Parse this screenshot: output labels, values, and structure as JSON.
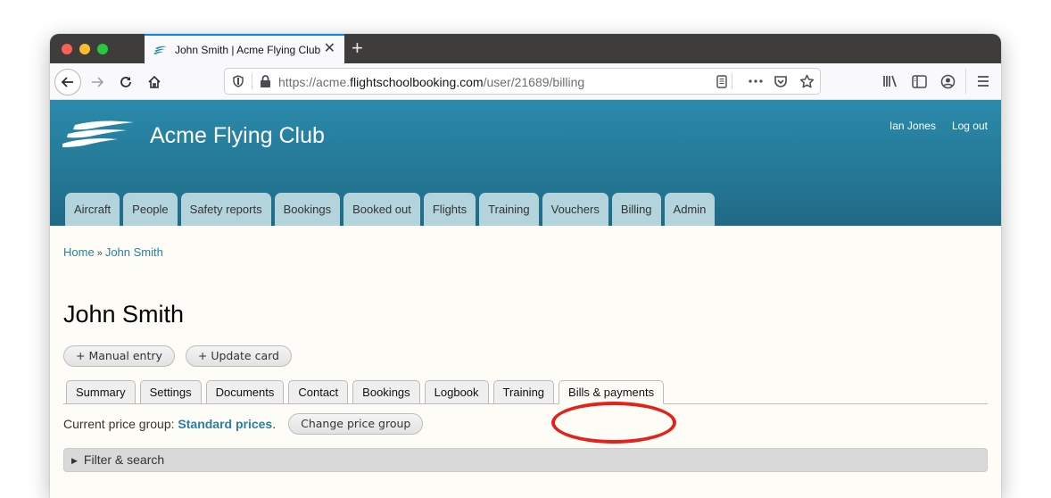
{
  "browser": {
    "tab_title": "John Smith | Acme Flying Club",
    "tab_close": "✕",
    "new_tab": "+",
    "url_prefix": "https://acme.",
    "url_host": "flightschoolbooking.com",
    "url_path": "/user/21689/billing"
  },
  "site": {
    "title": "Acme Flying Club",
    "user_name": "Ian Jones",
    "logout": "Log out",
    "brand_color": "#2b8aab",
    "nav": [
      "Aircraft",
      "People",
      "Safety reports",
      "Bookings",
      "Booked out",
      "Flights",
      "Training",
      "Vouchers",
      "Billing",
      "Admin"
    ]
  },
  "breadcrumb": {
    "home": "Home",
    "separator": "»",
    "current": "John Smith"
  },
  "page": {
    "title": "John Smith",
    "actions": {
      "manual_entry": "+ Manual entry",
      "update_card": "+ Update card"
    },
    "subtabs": [
      "Summary",
      "Settings",
      "Documents",
      "Contact",
      "Bookings",
      "Logbook",
      "Training",
      "Bills & payments"
    ],
    "active_subtab": "Bills & payments",
    "price_group": {
      "label": "Current price group:",
      "value": "Standard prices",
      "suffix": ".",
      "change_button": "Change price group"
    },
    "filter": {
      "toggle": "▶",
      "label": "Filter & search"
    }
  },
  "annotation": {
    "color": "#e3231b",
    "target": "Bills & payments"
  }
}
